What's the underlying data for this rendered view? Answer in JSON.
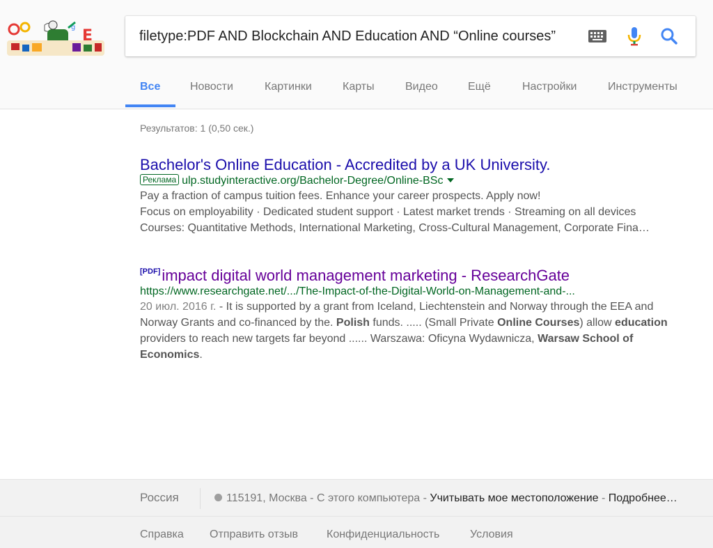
{
  "search": {
    "query": "filetype:PDF AND Blockchain AND Education AND “Online courses”"
  },
  "icons": {
    "keyboard": "keyboard-icon",
    "mic": "microphone-icon",
    "search": "search-icon"
  },
  "tabs": [
    {
      "label": "Все",
      "active": true
    },
    {
      "label": "Новости"
    },
    {
      "label": "Картинки"
    },
    {
      "label": "Карты"
    },
    {
      "label": "Видео"
    },
    {
      "label": "Ещё"
    },
    {
      "label": "Настройки"
    },
    {
      "label": "Инструменты"
    }
  ],
  "stats": "Результатов: 1 (0,50 сек.)",
  "results": [
    {
      "title": "Bachelor's Online Education - Accredited by a UK University.",
      "ad_label": "Реклама",
      "url": "ulp.studyinteractive.org/Bachelor-Degree/Online-BSc",
      "lines": [
        "Pay a fraction of campus tuition fees. Enhance your career prospects. Apply now!",
        "Focus on employability · Dedicated student support · Latest market trends · Streaming on all devices",
        "Courses: Quantitative Methods, International Marketing, Cross-Cultural Management, Corporate Fina…"
      ]
    },
    {
      "pdf_tag": "[PDF]",
      "title": "impact digital world management marketing - ResearchGate",
      "url": "https://www.researchgate.net/.../The-Impact-of-the-Digital-World-on-Management-and-...",
      "date": "20 июл. 2016 г.",
      "snippet": {
        "p1": " - It is supported by a grant from Iceland, Liechtenstein and Norway through the EEA and Norway Grants and co-financed by the. ",
        "b1": "Polish",
        "p2": " funds. ..... (Small Private ",
        "b2": "Online Courses",
        "p3": ") allow ",
        "b3": "education",
        "p4": " providers to reach new targets far beyond ...... Warszawa: Oficyna Wydawnicza, ",
        "b4": "Warsaw School of Economics",
        "p5": "."
      }
    }
  ],
  "footer": {
    "country": "Россия",
    "postal": "115191, Москва",
    "sep1": " - ",
    "source": "С этого компьютера",
    "sep2": " - ",
    "use_location": "Учитывать мое местоположение",
    "sep3": " - ",
    "more": "Подробнее…",
    "links": [
      "Справка",
      "Отправить отзыв",
      "Конфиденциальность",
      "Условия"
    ]
  },
  "colors": {
    "accent": "#4285f4",
    "link": "#1a0dab",
    "visited": "#660099",
    "url_green": "#006621"
  }
}
